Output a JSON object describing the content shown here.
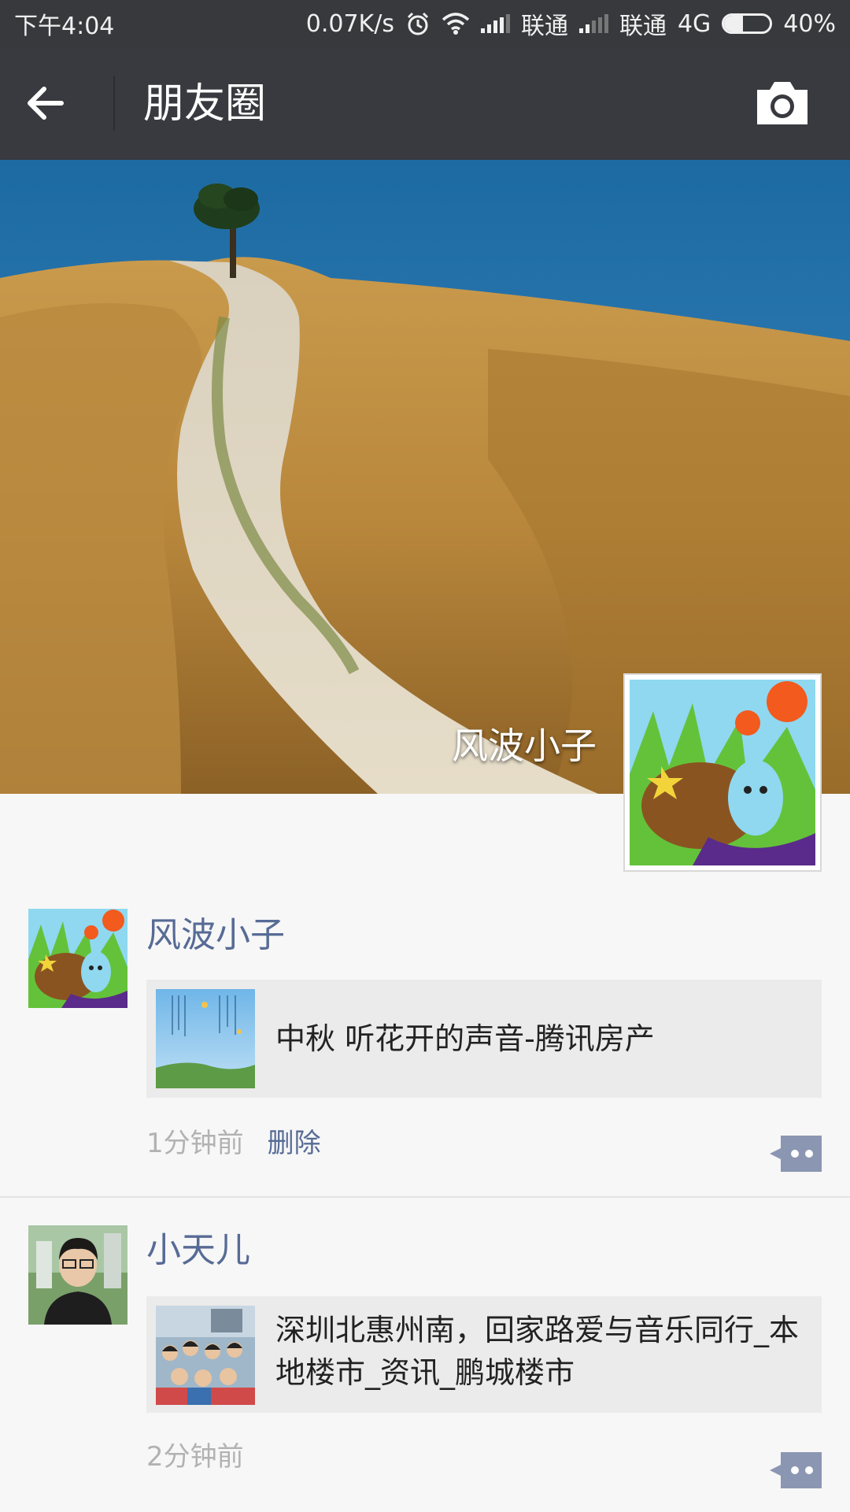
{
  "status_bar": {
    "time": "下午4:04",
    "speed": "0.07K/s",
    "carrier1": "联通",
    "carrier2": "联通",
    "network": "4G",
    "battery_text": "40%",
    "battery_level": 0.4,
    "icons": [
      "alarm-icon",
      "wifi-icon",
      "signal-icon",
      "signal-icon",
      "battery-icon"
    ]
  },
  "nav": {
    "title": "朋友圈",
    "back_icon": "arrow-left-icon",
    "camera_icon": "camera-icon"
  },
  "cover": {
    "user_name": "风波小子"
  },
  "feed": [
    {
      "username": "风波小子",
      "link_title": "中秋 听花开的声音-腾讯房产",
      "time": "1分钟前",
      "delete_label": "删除"
    },
    {
      "username": "小天儿",
      "link_title": "深圳北惠州南，回家路爱与音乐同行_本地楼市_资讯_鹏城楼市",
      "time": "2分钟前"
    }
  ],
  "colors": {
    "nav_bg": "#393a3f",
    "status_bg": "#38393d",
    "link_blue": "#576b95",
    "card_bg": "#ebebeb",
    "page_bg": "#f7f7f7"
  }
}
